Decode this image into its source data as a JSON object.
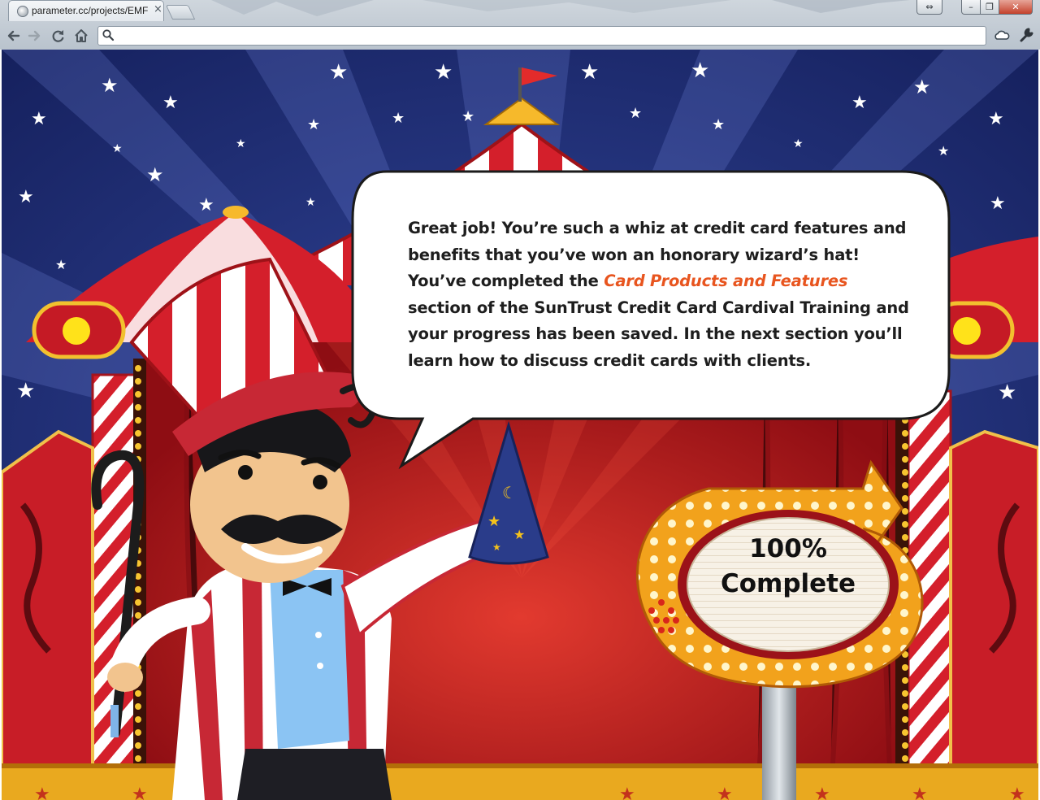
{
  "browser": {
    "tab_title": "parameter.cc/projects/EMF",
    "tab_close": "×",
    "address_value": "",
    "icons": [
      "globe-icon",
      "close-icon",
      "new-tab-icon",
      "resize-icon",
      "minimize-icon",
      "maximize-icon",
      "close-window-icon",
      "back-arrow-icon",
      "forward-arrow-icon",
      "reload-icon",
      "home-icon",
      "search-icon",
      "cloud-icon",
      "wrench-icon"
    ]
  },
  "message": {
    "part1": "Great job! You’re such a whiz at credit card features and benefits that you’ve won an honorary wizard’s hat! You’ve completed the ",
    "highlight": "Card Products and Features",
    "part2": " section of the SunTrust Credit Card Cardival Training and your progress has been saved. In the next section you’ll learn how to discuss credit cards with clients.",
    "highlight_color": "#e8551f"
  },
  "progress": {
    "percent_label": "100%",
    "status_label": "Complete",
    "value": 1.0
  },
  "colors": {
    "sky": "#1d2a72",
    "tent_red": "#d01f2b",
    "sign_gold": "#f5a623",
    "curtain": "#b3121a"
  }
}
